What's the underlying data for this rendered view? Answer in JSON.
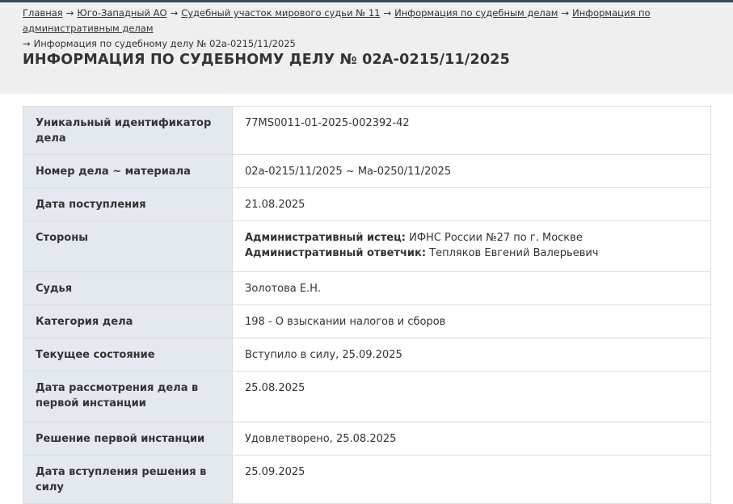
{
  "breadcrumb": {
    "items": [
      "Главная",
      "Юго-Западный АО",
      "Судебный участок мирового судьи № 11",
      "Информация по судебным делам",
      "Информация по административным делам"
    ],
    "current": "Информация по судебному делу № 02а-0215/11/2025",
    "separator": "→"
  },
  "page_title": "ИНФОРМАЦИЯ ПО СУДЕБНОМУ ДЕЛУ № 02А-0215/11/2025",
  "rows": [
    {
      "label": "Уникальный идентификатор дела",
      "value": "77MS0011-01-2025-002392-42"
    },
    {
      "label": "Номер дела ~ материала",
      "value": "02а-0215/11/2025 ~ Ма-0250/11/2025"
    },
    {
      "label": "Дата поступления",
      "value": "21.08.2025"
    },
    {
      "label": "Стороны",
      "parties": [
        {
          "role": "Административный истец:",
          "name": "ИФНС России №27 по г. Москве"
        },
        {
          "role": "Административный ответчик:",
          "name": "Тепляков Евгений Валерьевич"
        }
      ]
    },
    {
      "label": "Судья",
      "value": "Золотова Е.Н."
    },
    {
      "label": "Категория дела",
      "value": "198 - О взыскании налогов и сборов"
    },
    {
      "label": "Текущее состояние",
      "value": "Вступило в силу, 25.09.2025"
    },
    {
      "label": "Дата рассмотрения дела в первой инстанции",
      "value": "25.08.2025"
    },
    {
      "label": "Решение первой инстанции",
      "value": "Удовлетворено, 25.08.2025"
    },
    {
      "label": "Дата вступления решения в силу",
      "value": "25.09.2025"
    }
  ]
}
